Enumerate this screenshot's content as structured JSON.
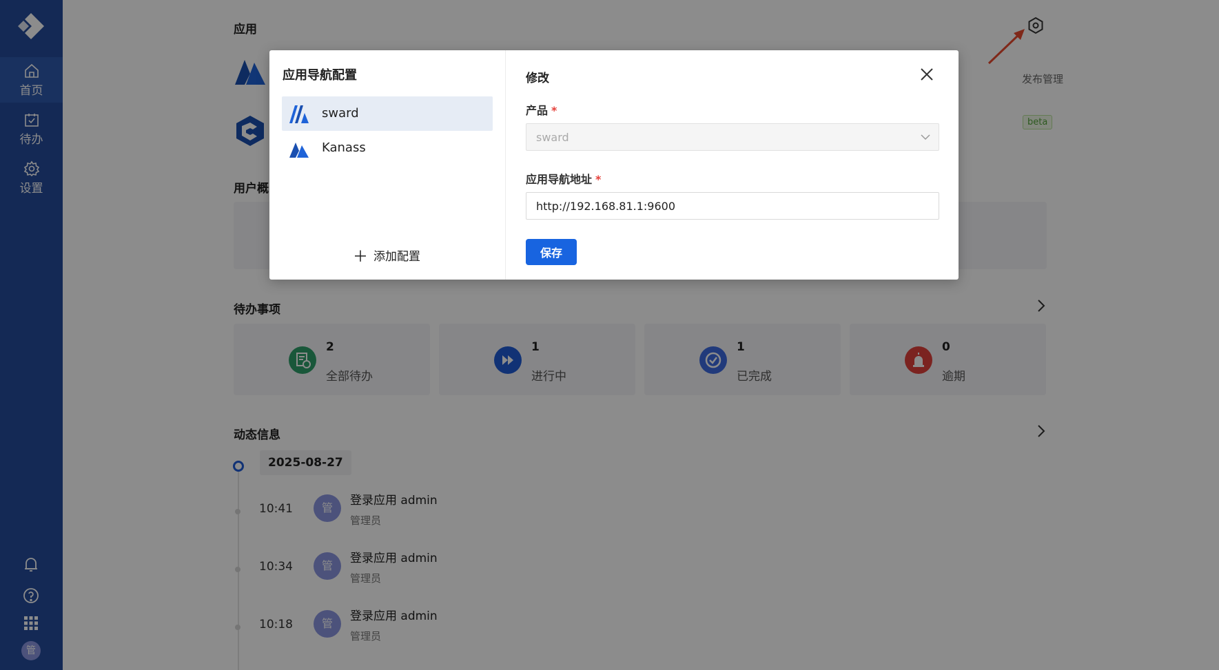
{
  "sidebar": {
    "items": [
      {
        "label": "首页",
        "icon": "home-icon",
        "active": true
      },
      {
        "label": "待办",
        "icon": "calendar-check-icon"
      },
      {
        "label": "设置",
        "icon": "gear-icon"
      }
    ],
    "avatar_text": "管"
  },
  "main": {
    "apps_title": "应用",
    "publish_label": "发布管理",
    "beta_label": "beta",
    "user_overview_title": "用户概",
    "todo_title": "待办事项",
    "todo_cards": [
      {
        "count": "2",
        "label": "全部待办",
        "color": "#2e9e6a"
      },
      {
        "count": "1",
        "label": "进行中",
        "color": "#1f5bd6"
      },
      {
        "count": "1",
        "label": "已完成",
        "color": "#3d6be0"
      },
      {
        "count": "0",
        "label": "逾期",
        "color": "#e0413b"
      }
    ],
    "activity_title": "动态信息",
    "activity_date": "2025-08-27",
    "activities": [
      {
        "time": "10:41",
        "avatar": "管",
        "title": "登录应用 admin",
        "sub": "管理员"
      },
      {
        "time": "10:34",
        "avatar": "管",
        "title": "登录应用 admin",
        "sub": "管理员"
      },
      {
        "time": "10:18",
        "avatar": "管",
        "title": "登录应用 admin",
        "sub": "管理员"
      }
    ]
  },
  "modal": {
    "left_title": "应用导航配置",
    "configs": [
      {
        "name": "sward",
        "selected": true
      },
      {
        "name": "Kanass",
        "selected": false
      }
    ],
    "add_label": "添加配置",
    "right_title": "修改",
    "product_label": "产品",
    "product_value": "sward",
    "url_label": "应用导航地址",
    "url_value": "http://192.168.81.1:9600",
    "save_label": "保存",
    "required_mark": "*"
  },
  "colors": {
    "sidebar": "#264c9c",
    "primary": "#1864e0",
    "required": "#e5403a",
    "arrow": "#e84a2f"
  }
}
